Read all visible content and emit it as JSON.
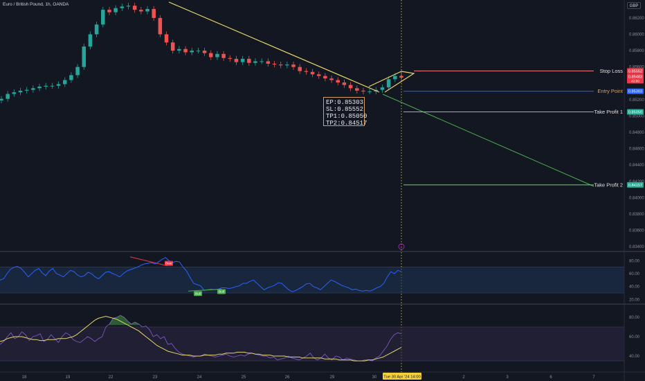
{
  "header": {
    "symbol_line": "Euro / British Pound, 1h, OANDA",
    "currency": "GBP"
  },
  "chart_data": {
    "type": "candlestick",
    "title": "Euro / British Pound, 1h, OANDA",
    "x_ticks": [
      "18",
      "19",
      "22",
      "23",
      "24",
      "25",
      "26",
      "29",
      "30",
      "2",
      "3",
      "6",
      "7"
    ],
    "crosshair_label": "Tue 30 Apr '24",
    "crosshair_time": "14:00",
    "price_axis": {
      "ticks": [
        "0.86200",
        "0.86000",
        "0.85800",
        "0.85600",
        "0.85200",
        "0.85000",
        "0.84800",
        "0.84600",
        "0.84400",
        "0.84200",
        "0.84000",
        "0.83800",
        "0.83600",
        "0.83400"
      ],
      "range": [
        0.8335,
        0.8642
      ]
    },
    "price_close_series": [
      0.8521,
      0.8527,
      0.8529,
      0.8531,
      0.8532,
      0.8534,
      0.8536,
      0.8537,
      0.8537,
      0.8539,
      0.8544,
      0.855,
      0.856,
      0.8585,
      0.86,
      0.8612,
      0.863,
      0.8627,
      0.8632,
      0.8634,
      0.8635,
      0.863,
      0.8628,
      0.8631,
      0.862,
      0.86,
      0.859,
      0.858,
      0.8582,
      0.8578,
      0.858,
      0.858,
      0.8577,
      0.8572,
      0.8576,
      0.8571,
      0.857,
      0.8566,
      0.857,
      0.8565,
      0.8567,
      0.8567,
      0.8564,
      0.8563,
      0.8562,
      0.8563,
      0.856,
      0.8555,
      0.8554,
      0.8551,
      0.8549,
      0.8546,
      0.8544,
      0.8541,
      0.8538,
      0.8534,
      0.8531,
      0.853,
      0.853,
      0.8532,
      0.8535,
      0.8545,
      0.8549,
      0.8547
    ],
    "labels": [
      {
        "name": "Stop Loss",
        "price": 0.85552,
        "tag": "0.85552",
        "color": "#f7525f"
      },
      {
        "name": "Entry Point",
        "price": 0.85303,
        "tag": "0.85303",
        "color": "#2962ff"
      },
      {
        "name": "Take Profit 1",
        "price": 0.8505,
        "tag": "0.85050",
        "color": "#26a69a"
      },
      {
        "name": "Take Profit 2",
        "price": 0.84157,
        "tag": "0.84157",
        "color": "#26a69a"
      }
    ],
    "current_price": {
      "value": "0.85483",
      "countdown": "42:00"
    },
    "info_box": [
      {
        "k": "EP:",
        "v": "0.85303"
      },
      {
        "k": "SL:",
        "v": "0.85552"
      },
      {
        "k": "TP1:",
        "v": "0.85050"
      },
      {
        "k": "TP2:",
        "v": "0.84517"
      }
    ],
    "rsi_panel": {
      "ticks": [
        "80.00",
        "60.00",
        "40.00",
        "20.00"
      ],
      "range": [
        15,
        90
      ],
      "band": [
        30,
        70
      ],
      "series": [
        50,
        52,
        60,
        67,
        70,
        71,
        68,
        62,
        55,
        60,
        65,
        68,
        61,
        57,
        64,
        68,
        60,
        58,
        55,
        60,
        65,
        63,
        58,
        55,
        57,
        62,
        60,
        55,
        52,
        57,
        62,
        63,
        60,
        58,
        55,
        60,
        64,
        66,
        68,
        70,
        73,
        75,
        76,
        77,
        75,
        78,
        82,
        85,
        80,
        77,
        79,
        78,
        70,
        64,
        54,
        45,
        43,
        41,
        34,
        35,
        36,
        35,
        36,
        38,
        38,
        37,
        38,
        40,
        41,
        45,
        45,
        48,
        50,
        45,
        40,
        35,
        38,
        40,
        42,
        46,
        45,
        40,
        35,
        32,
        34,
        37,
        40,
        44,
        45,
        40,
        38,
        35,
        40,
        45,
        50,
        48,
        45,
        42,
        40,
        38,
        35,
        36,
        34,
        33,
        34,
        33,
        35,
        38,
        40,
        45,
        55,
        63,
        60,
        65,
        63
      ],
      "markers": [
        {
          "text": "Bear",
          "value": 70
        },
        {
          "text": "Bull",
          "value": 34
        },
        {
          "text": "Bull",
          "value": 37
        }
      ]
    },
    "osc_panel": {
      "ticks": [
        "80.00",
        "60.00",
        "40.00"
      ],
      "range": [
        25,
        90
      ],
      "band": [
        35,
        70
      ],
      "fast": [
        52,
        55,
        60,
        64,
        58,
        60,
        65,
        62,
        56,
        60,
        61,
        63,
        55,
        57,
        62,
        58,
        54,
        60,
        64,
        62,
        57,
        55,
        54,
        57,
        60,
        58,
        55,
        58,
        60,
        70,
        73,
        79,
        80,
        82,
        80,
        76,
        73,
        75,
        73,
        70,
        71,
        67,
        60,
        62,
        58,
        60,
        52,
        53,
        48,
        44,
        42,
        41,
        40,
        39,
        40,
        40,
        42,
        41,
        40,
        39,
        40,
        41,
        42,
        40,
        39,
        40,
        41,
        40,
        42,
        43,
        42,
        41,
        40,
        40,
        38,
        39,
        36,
        37,
        38,
        40,
        38,
        37,
        36,
        38,
        40,
        43,
        38,
        36,
        38,
        42,
        38,
        36,
        40,
        39,
        36,
        38,
        37,
        36,
        35,
        35,
        36,
        36,
        35,
        38,
        40,
        45,
        50,
        57,
        62,
        64,
        63
      ],
      "slow": [
        55,
        56,
        58,
        59,
        60,
        60,
        60,
        59,
        58,
        57,
        57,
        56,
        56,
        57,
        57,
        57,
        58,
        58,
        58,
        59,
        60,
        62,
        65,
        68,
        71,
        74,
        77,
        79,
        80,
        81,
        80,
        79,
        78,
        76,
        74,
        72,
        70,
        68,
        66,
        63,
        60,
        57,
        54,
        51,
        49,
        47,
        45,
        44,
        43,
        42,
        41,
        41,
        41,
        40,
        40,
        40,
        41,
        41,
        41,
        41,
        42,
        42,
        43,
        43,
        43,
        44,
        44,
        44,
        43,
        43,
        42,
        42,
        41,
        41,
        41,
        40,
        40,
        40,
        40,
        39,
        39,
        39,
        39,
        38,
        38,
        38,
        38,
        38,
        38,
        37,
        37,
        37,
        37,
        36,
        36,
        36,
        36,
        35,
        35,
        35,
        35,
        36,
        36,
        37,
        38,
        39,
        41,
        43,
        45,
        47,
        49
      ]
    }
  }
}
